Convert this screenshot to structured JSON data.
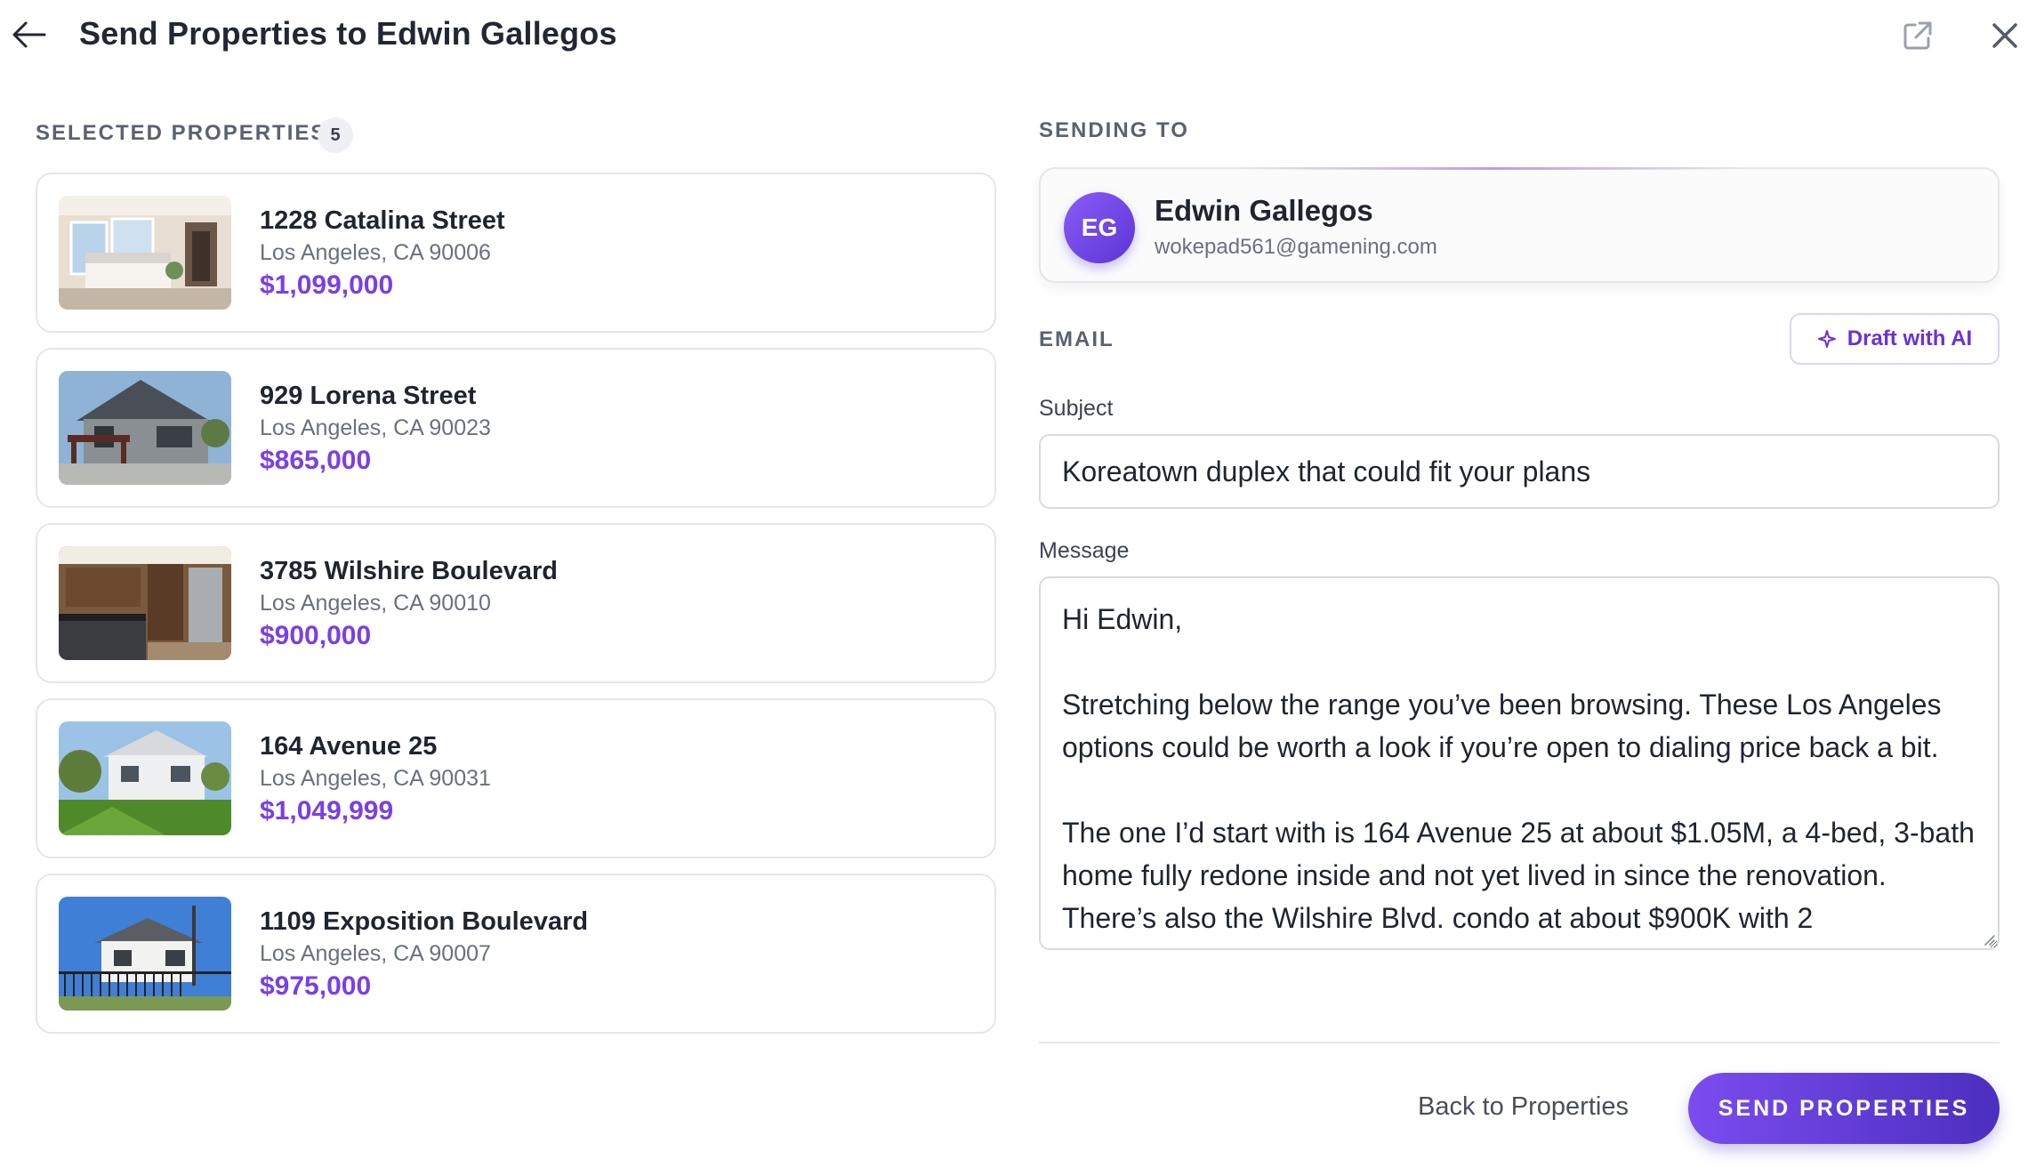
{
  "header": {
    "title": "Send Properties to Edwin Gallegos",
    "back_icon": "arrow-left-icon",
    "external_icon": "external-link-icon",
    "close_icon": "close-icon"
  },
  "selected": {
    "label": "SELECTED PROPERTIES",
    "count": "5",
    "properties": [
      {
        "name": "1228 Catalina Street",
        "city": "Los Angeles, CA 90006",
        "price": "$1,099,000",
        "thumb": "bedroom"
      },
      {
        "name": "929 Lorena Street",
        "city": "Los Angeles, CA 90023",
        "price": "$865,000",
        "thumb": "craftsman-house"
      },
      {
        "name": "3785 Wilshire Boulevard",
        "city": "Los Angeles, CA 90010",
        "price": "$900,000",
        "thumb": "kitchen"
      },
      {
        "name": "164 Avenue 25",
        "city": "Los Angeles, CA 90031",
        "price": "$1,049,999",
        "thumb": "white-house-lawn"
      },
      {
        "name": "1109 Exposition Boulevard",
        "city": "Los Angeles, CA 90007",
        "price": "$975,000",
        "thumb": "bungalow-fence"
      }
    ]
  },
  "sending": {
    "label": "SENDING TO",
    "initials": "EG",
    "name": "Edwin Gallegos",
    "email": "wokepad561@gamening.com"
  },
  "email": {
    "label": "EMAIL",
    "draft_label": "Draft with AI",
    "draft_icon": "sparkle-icon",
    "subject_label": "Subject",
    "subject_value": "Koreatown duplex that could fit your plans",
    "message_label": "Message",
    "message_value": "Hi Edwin,\n\nStretching below the range you’ve been browsing. These Los Angeles options could be worth a look if you’re open to dialing price back a bit.\n\nThe one I’d start with is 164 Avenue 25 at about $1.05M, a 4-bed, 3-bath home fully redone inside and not yet lived in since the renovation. There’s also the Wilshire Blvd. condo at about $900K with 2"
  },
  "footer": {
    "back_label": "Back to Properties",
    "send_label": "SEND PROPERTIES"
  },
  "colors": {
    "accent": "#7b3fe4",
    "send_button_start": "#7b4cef",
    "send_button_end": "#4c2fbf"
  }
}
